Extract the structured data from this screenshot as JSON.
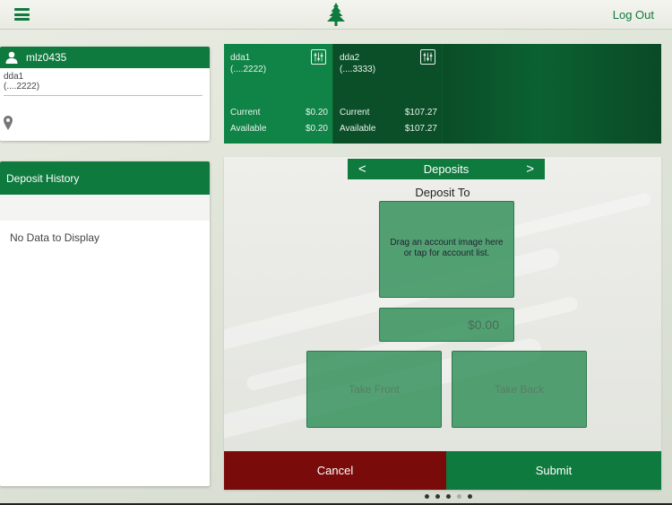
{
  "header": {
    "menu_icon": "hamburger-icon",
    "logo_icon": "cedar-tree-icon",
    "logout_label": "Log Out"
  },
  "user": {
    "icon": "user-icon",
    "username": "mlz0435",
    "account_name": "dda1",
    "account_number": "(....2222)",
    "location_icon": "map-pin-icon"
  },
  "history": {
    "title": "Deposit History",
    "empty_message": "No Data to Display"
  },
  "accounts": [
    {
      "name": "dda1",
      "number": "(....2222)",
      "current_label": "Current",
      "current_value": "$0.20",
      "available_label": "Available",
      "available_value": "$0.20"
    },
    {
      "name": "dda2",
      "number": "(....3333)",
      "current_label": "Current",
      "current_value": "$107.27",
      "available_label": "Available",
      "available_value": "$107.27"
    }
  ],
  "deposit": {
    "prev_arrow": "<",
    "title": "Deposits",
    "next_arrow": ">",
    "deposit_to_label": "Deposit To",
    "drop_hint_line1": "Drag an account image here",
    "drop_hint_line2": "or tap for account list.",
    "amount_placeholder": "$0.00",
    "take_front_label": "Take Front",
    "take_back_label": "Take Back",
    "cancel_label": "Cancel",
    "submit_label": "Submit"
  },
  "pager": {
    "total": 5,
    "active_index": 3
  },
  "colors": {
    "brand_green": "#0f7a3e",
    "cancel_red": "#7a0b0b",
    "dark_green": "#0b4f29"
  }
}
